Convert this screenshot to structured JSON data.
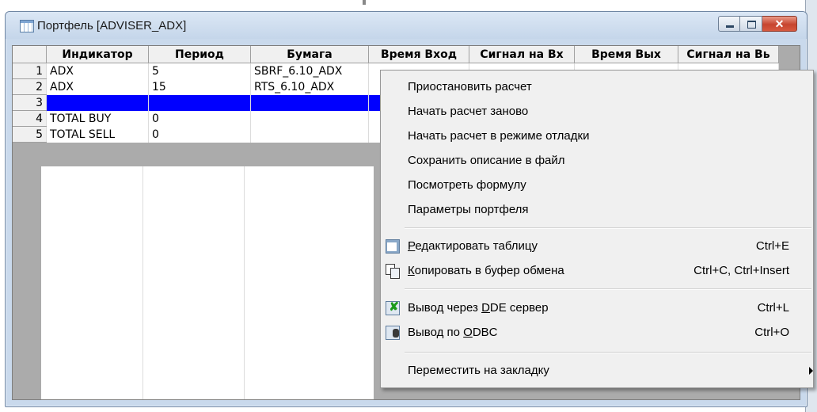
{
  "window": {
    "title": "Портфель [ADVISER_ADX]",
    "close_glyph": "✕"
  },
  "table": {
    "columns": [
      "Индикатор",
      "Период",
      "Бумага",
      "Время Вход",
      "Сигнал на Вх",
      "Время Вых",
      "Сигнал на Вь"
    ],
    "rows": [
      {
        "num": "1",
        "cells": [
          "ADX",
          "5",
          "SBRF_6.10_ADX"
        ]
      },
      {
        "num": "2",
        "cells": [
          "ADX",
          "15",
          "RTS_6.10_ADX"
        ]
      },
      {
        "num": "3",
        "cells": [
          "",
          "",
          ""
        ],
        "selected": true
      },
      {
        "num": "4",
        "cells": [
          "TOTAL BUY",
          "0",
          ""
        ]
      },
      {
        "num": "5",
        "cells": [
          "TOTAL SELL",
          "0",
          ""
        ]
      }
    ]
  },
  "menu": {
    "items": [
      {
        "label": "Приостановить расчет"
      },
      {
        "label": "Начать расчет заново"
      },
      {
        "label": "Начать расчет в режиме отладки"
      },
      {
        "label": "Сохранить описание в файл"
      },
      {
        "label": "Посмотреть формулу"
      },
      {
        "label": "Параметры портфеля"
      }
    ],
    "edit": {
      "hot": "Р",
      "rest": "едактировать таблицу",
      "shortcut": "Ctrl+E",
      "icon": "edit-table-icon"
    },
    "copy": {
      "hot": "К",
      "rest": "опировать в буфер обмена",
      "shortcut": "Ctrl+C, Ctrl+Insert",
      "icon": "copy-icon"
    },
    "dde": {
      "pre": "Вывод через ",
      "hot": "D",
      "rest": "DE сервер",
      "shortcut": "Ctrl+L",
      "icon": "dde-server-icon",
      "icon_glyph": "✘"
    },
    "odbc": {
      "pre": "Вывод по ",
      "hot": "O",
      "rest": "DBC",
      "shortcut": "Ctrl+O",
      "icon": "odbc-icon"
    },
    "move": {
      "label": "Переместить на закладку"
    }
  }
}
